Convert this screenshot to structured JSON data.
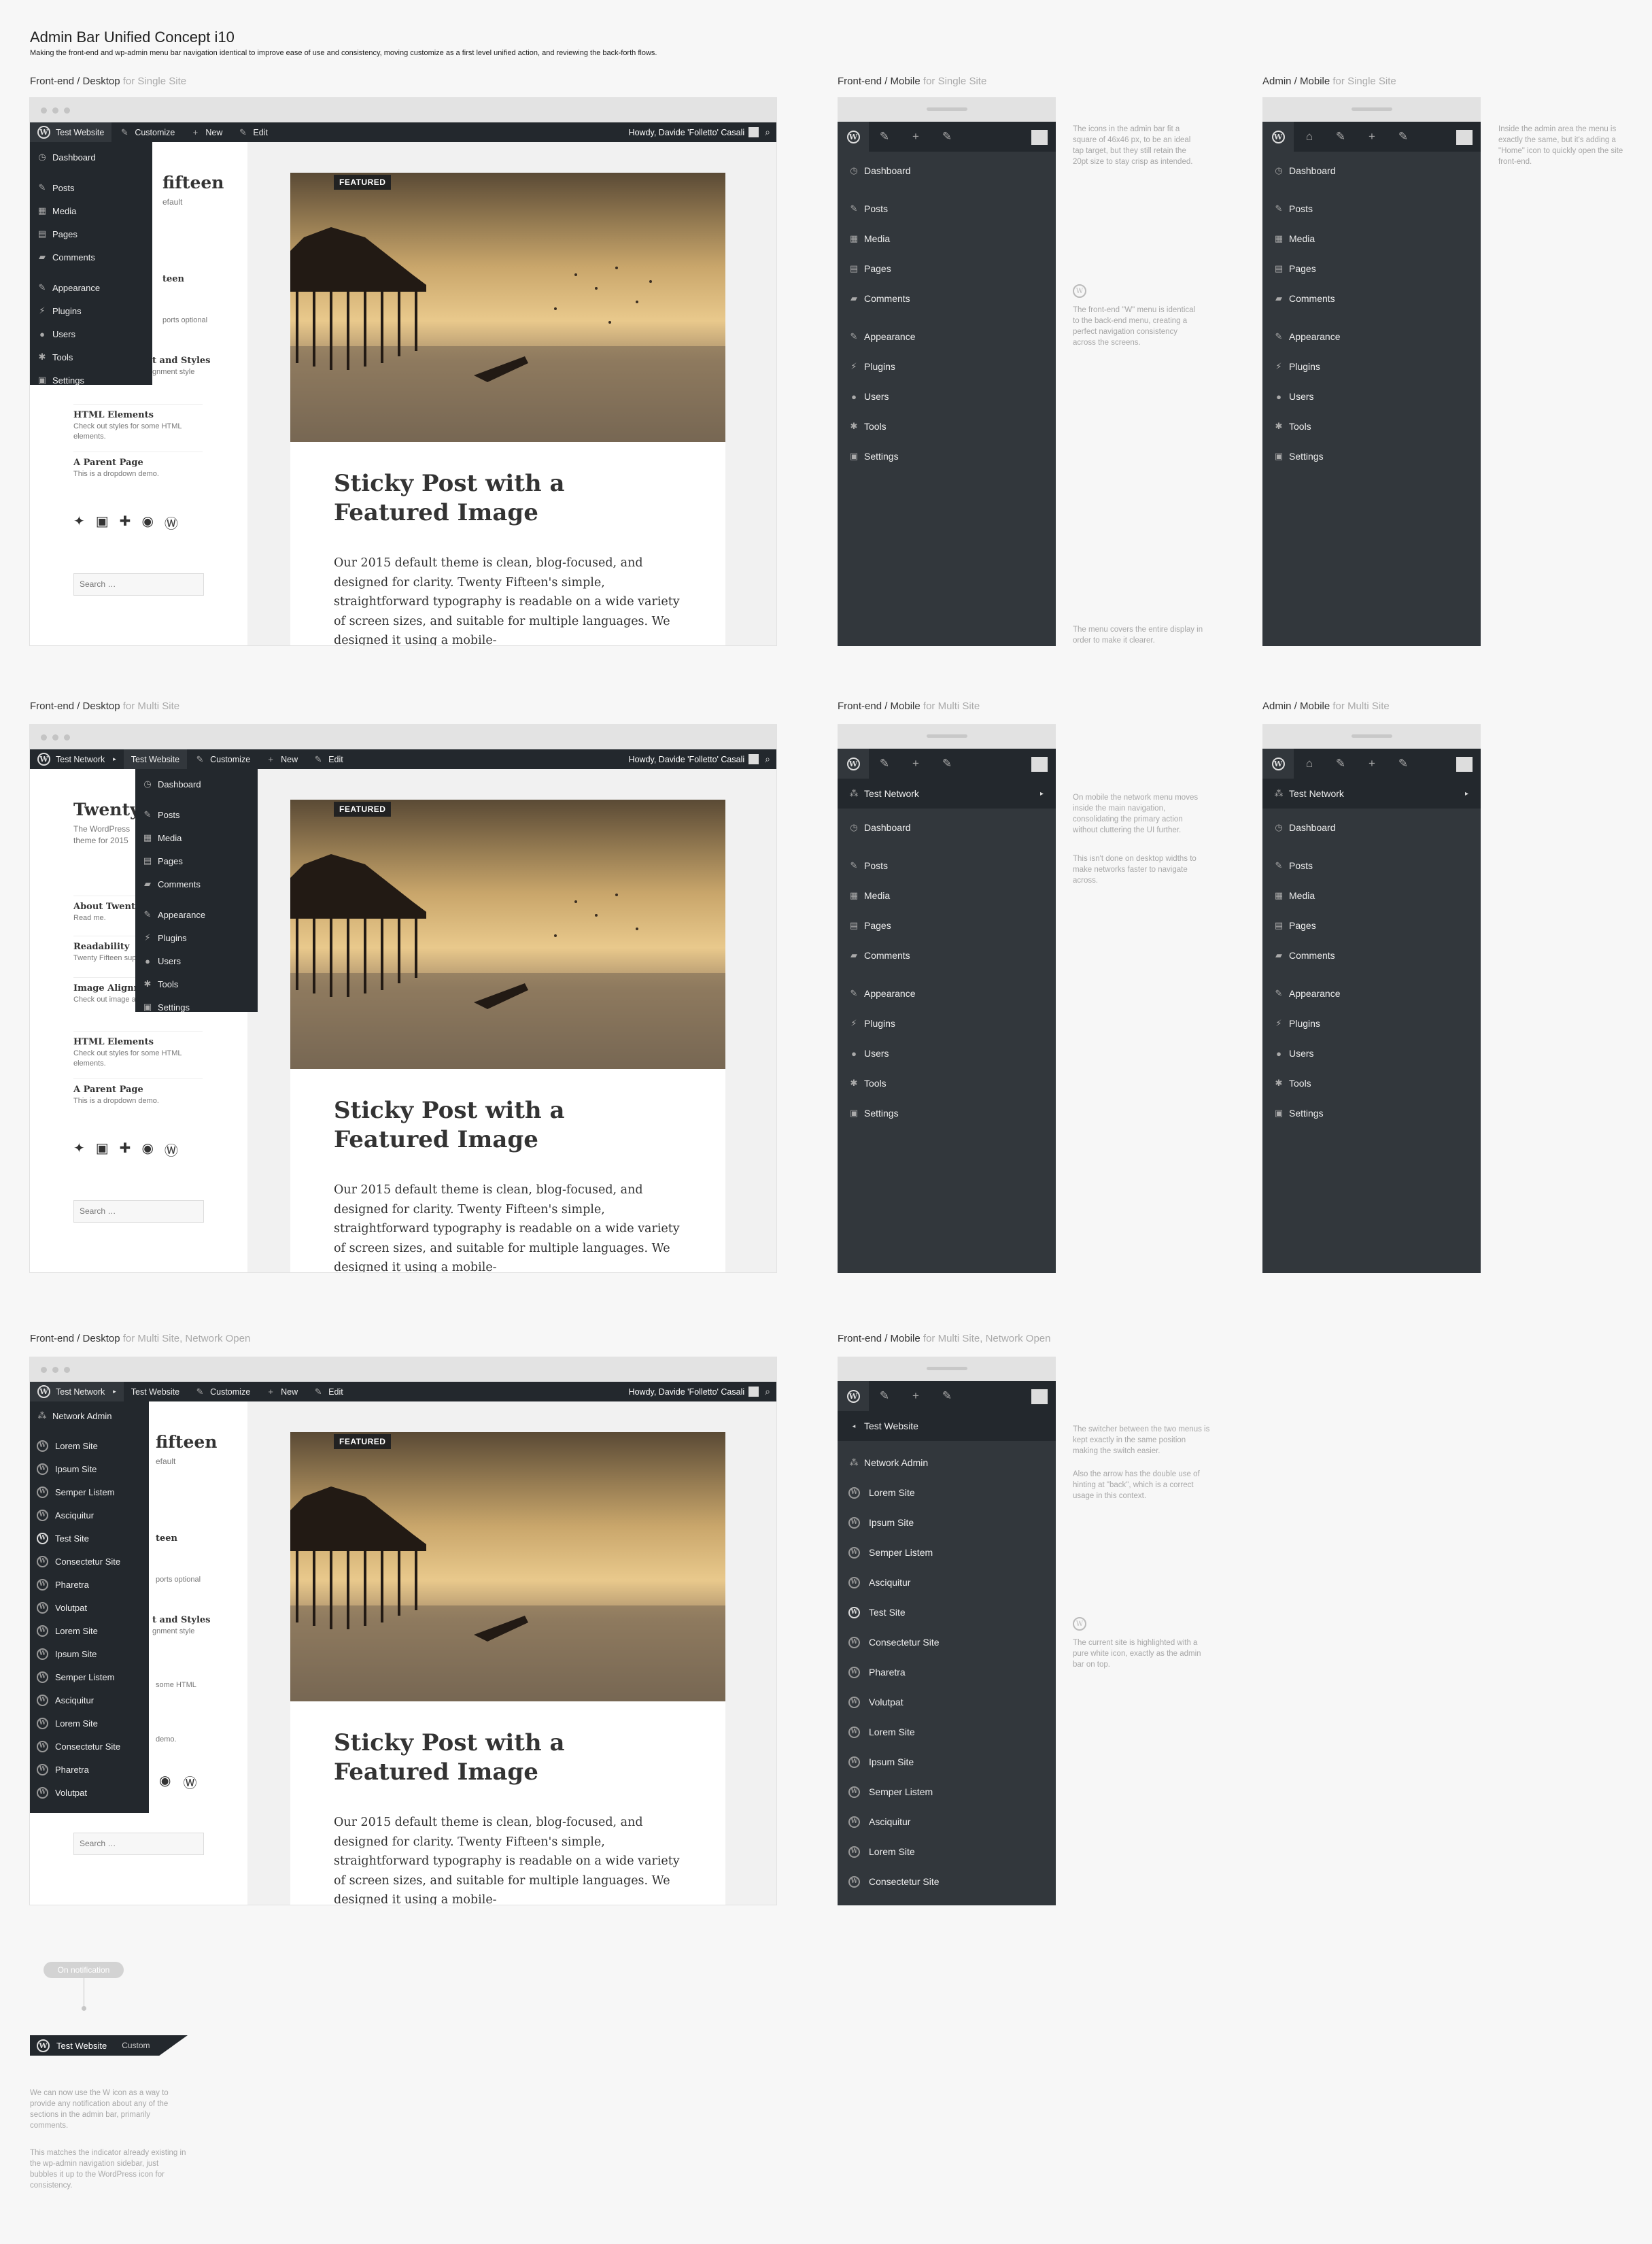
{
  "title": "Admin Bar Unified Concept i10",
  "subtitle": "Making the front-end and wp-admin menu bar navigation identical to improve ease of use and consistency, moving customize as a first level unified action, and reviewing the back-forth flows.",
  "labels": {
    "fd_single": [
      "Front-end / Desktop",
      "for Single Site"
    ],
    "fm_single": [
      "Front-end / Mobile",
      "for Single Site"
    ],
    "am_single": [
      "Admin / Mobile",
      "for Single Site"
    ],
    "fd_multi": [
      "Front-end / Desktop",
      "for Multi Site"
    ],
    "fm_multi": [
      "Front-end / Mobile",
      "for Multi Site"
    ],
    "am_multi": [
      "Admin / Mobile",
      "for Multi Site"
    ],
    "fd_net": [
      "Front-end / Desktop",
      "for Multi Site, Network Open"
    ],
    "fm_net": [
      "Front-end / Mobile",
      "for Multi Site, Network Open"
    ]
  },
  "notes": {
    "icons": "The icons in the admin bar fit a square of 46x46 px, to be an ideal tap target, but they still retain the 20pt size to stay crisp as intended.",
    "wmenu": "The front-end \"W\" menu is identical to the back-end menu, creating a perfect navigation consistency across the screens.",
    "covers": "The menu covers the entire display in order to make it clearer.",
    "admin": "Inside the admin area the menu is exactly the same, but it's adding a \"Home\" icon to quickly open the site front-end.",
    "network1": "On mobile the network menu moves inside the main navigation, consolidating the primary action without cluttering the UI further.",
    "network2": "This isn't done on desktop widths to make networks faster to navigate across.",
    "switcher1": "The switcher between the two menus is kept exactly in the same position making the switch easier.",
    "switcher2": "Also the arrow has the double use of hinting at \"back\", which is a correct usage in this context.",
    "current": "The current site is highlighted with a pure white icon, exactly as the admin bar on top.",
    "notif1": "We can now use the W icon as a way to provide any notification about any of the sections in the admin bar, primarily comments.",
    "notif2": "This matches the indicator already existing in the wp-admin navigation sidebar, just bubbles it up to the WordPress icon for consistency."
  },
  "bar": {
    "site": "Test Website",
    "network": "Test Network",
    "customize": "Customize",
    "new": "New",
    "edit": "Edit",
    "howdy": "Howdy, Davide 'Folletto' Casali"
  },
  "menu": {
    "dashboard": "Dashboard",
    "posts": "Posts",
    "media": "Media",
    "pages": "Pages",
    "comments": "Comments",
    "appearance": "Appearance",
    "plugins": "Plugins",
    "users": "Users",
    "tools": "Tools",
    "settings": "Settings"
  },
  "network_menu": {
    "admin": "Network Admin",
    "sites": [
      "Lorem Site",
      "Ipsum Site",
      "Semper Listem",
      "Asciquitur",
      "Test Site",
      "Consectetur Site",
      "Pharetra",
      "Volutpat",
      "Lorem Site",
      "Ipsum Site",
      "Semper Listem",
      "Asciquitur",
      "Lorem Site",
      "Consectetur Site",
      "Pharetra",
      "Volutpat"
    ],
    "mobile_sites": [
      "Lorem Site",
      "Ipsum Site",
      "Semper Listem",
      "Asciquitur",
      "Test Site",
      "Consectetur Site",
      "Pharetra",
      "Volutpat",
      "Lorem Site",
      "Ipsum Site",
      "Semper Listem",
      "Asciquitur",
      "Lorem Site",
      "Consectetur Site"
    ]
  },
  "site": {
    "title1": "Twenty Fifteen",
    "title_frag": "fifteen",
    "title2": "Twenty",
    "desc_frag": "efault",
    "desc2": "The WordPress theme for 2015",
    "w_about": "About Twenty Fifteen",
    "w_about_frag": "teen",
    "w_about_sub": "Read me.",
    "w_read": "Readability",
    "w_read_frag": "ports optional",
    "w_read_sub": "Twenty Fifteen supports optional menu descriptions.",
    "w_img": "Image Alignment and Styles",
    "w_img_frag": "t and Styles",
    "w_img_sub": "Check out image alignment style here.",
    "w_img_sub_frag": "gnment style",
    "w_html": "HTML Elements",
    "w_html_sub": "Check out styles for some HTML elements.",
    "w_parent": "A Parent Page",
    "w_parent_sub": "This is a dropdown demo.",
    "w_parent_sub_frag": "demo.",
    "search": "Search …",
    "search_frag_html": "some HTML"
  },
  "post": {
    "badge": "FEATURED",
    "title": "Sticky Post with a Featured Image",
    "text": "Our 2015 default theme is clean, blog-focused, and designed for clarity. Twenty Fifteen's simple, straightforward typography is readable on a wide variety of screen sizes, and suitable for multiple languages. We designed it using a mobile-"
  },
  "notification": {
    "pill": "On notification",
    "site": "Test Website",
    "partial": "Custom"
  }
}
